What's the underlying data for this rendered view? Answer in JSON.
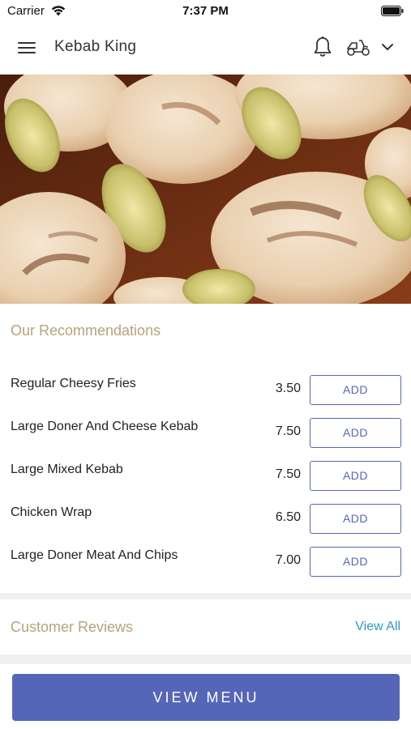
{
  "status_bar": {
    "carrier": "Carrier",
    "time": "7:37 PM"
  },
  "app_bar": {
    "title": "Kebab King",
    "icons": [
      "menu-icon",
      "bell-icon",
      "scooter-icon",
      "chevron-down-icon"
    ]
  },
  "hero": {
    "image": "grilled-chicken-skewers"
  },
  "recommendations": {
    "title": "Our Recommendations",
    "items": [
      {
        "name": "Regular Cheesy Fries",
        "price": "3.50",
        "button": "ADD"
      },
      {
        "name": "Large Doner And Cheese Kebab",
        "price": "7.50",
        "button": "ADD"
      },
      {
        "name": "Large Mixed Kebab",
        "price": "7.50",
        "button": "ADD"
      },
      {
        "name": "Chicken Wrap",
        "price": "6.50",
        "button": "ADD"
      },
      {
        "name": "Large Doner Meat And Chips",
        "price": "7.00",
        "button": "ADD"
      }
    ]
  },
  "reviews": {
    "title": "Customer Reviews",
    "view_all": "View All"
  },
  "cta": {
    "label": "VIEW MENU"
  },
  "colors": {
    "accent": "#5566b8",
    "section_title": "#b8a27a",
    "link": "#2b9bc4",
    "divider": "#f0f0f0"
  }
}
